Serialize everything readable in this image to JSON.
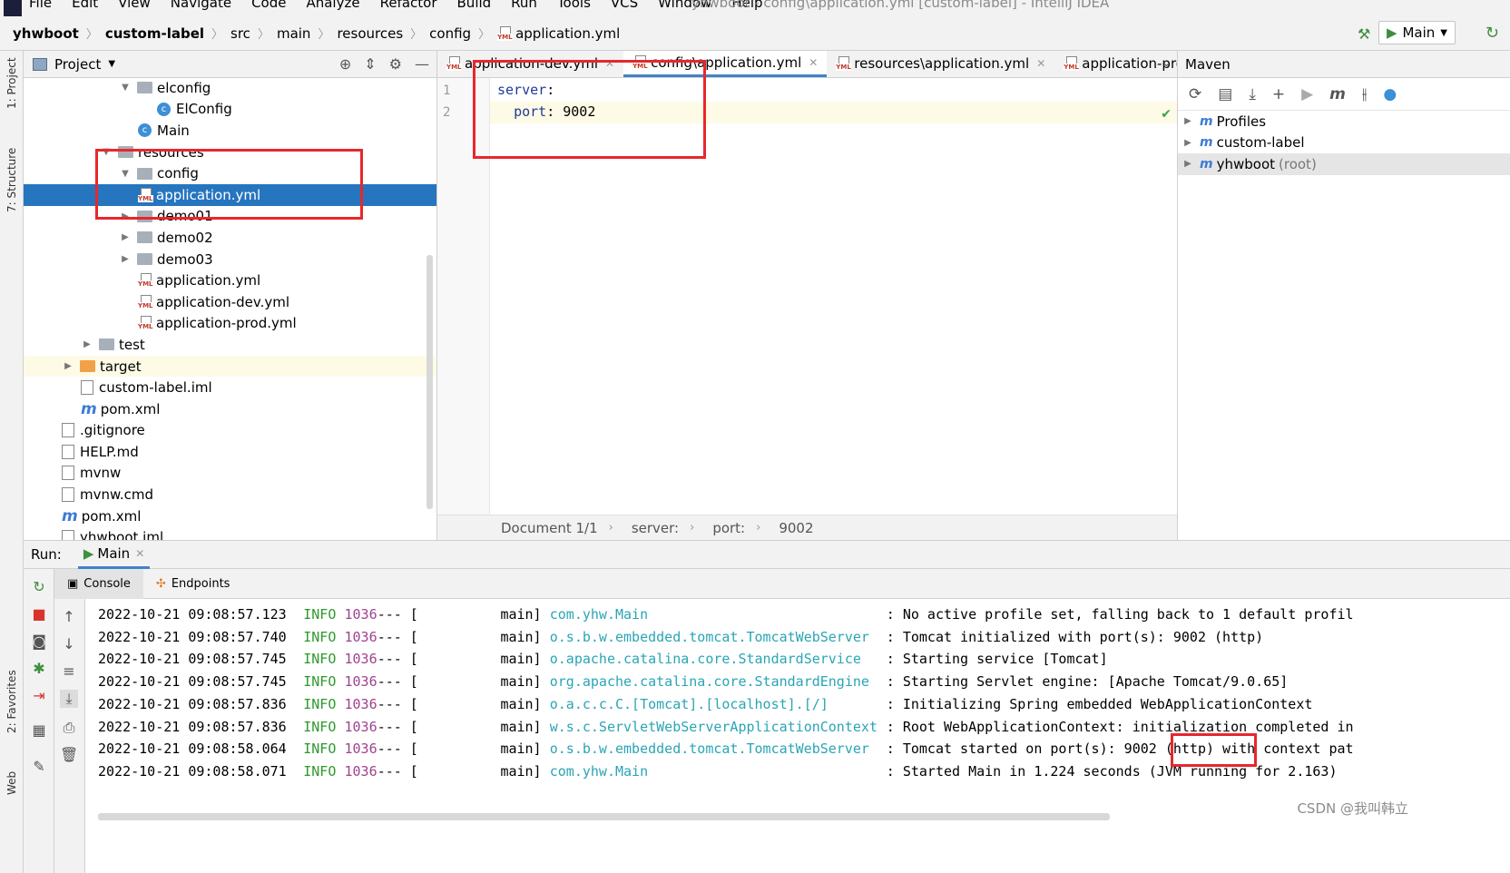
{
  "window_title": "yhwboot - config\\application.yml [custom-label] - IntelliJ IDEA",
  "menu": [
    "File",
    "Edit",
    "View",
    "Navigate",
    "Code",
    "Analyze",
    "Refactor",
    "Build",
    "Run",
    "Tools",
    "VCS",
    "Window",
    "Help"
  ],
  "breadcrumb": [
    "yhwboot",
    "custom-label",
    "src",
    "main",
    "resources",
    "config",
    "application.yml"
  ],
  "run_config": "Main",
  "side_labels": {
    "project": "1: Project",
    "structure": "7: Structure",
    "favorites": "2: Favorites",
    "web": "Web"
  },
  "project_panel": {
    "title": "Project",
    "tree": [
      {
        "label": "elconfig",
        "type": "package",
        "indent": 5,
        "arrow": "▼"
      },
      {
        "label": "ElConfig",
        "type": "class",
        "indent": 7,
        "arrow": ""
      },
      {
        "label": "Main",
        "type": "class-run",
        "indent": 6,
        "arrow": ""
      },
      {
        "label": "resources",
        "type": "folder-res",
        "indent": 4,
        "arrow": "▼"
      },
      {
        "label": "config",
        "type": "folder",
        "indent": 5,
        "arrow": "▼"
      },
      {
        "label": "application.yml",
        "type": "yml",
        "indent": 6,
        "arrow": "",
        "selected": true
      },
      {
        "label": "demo01",
        "type": "folder",
        "indent": 5,
        "arrow": "▶"
      },
      {
        "label": "demo02",
        "type": "folder",
        "indent": 5,
        "arrow": "▶"
      },
      {
        "label": "demo03",
        "type": "folder",
        "indent": 5,
        "arrow": "▶"
      },
      {
        "label": "application.yml",
        "type": "yml",
        "indent": 6,
        "arrow": ""
      },
      {
        "label": "application-dev.yml",
        "type": "yml",
        "indent": 6,
        "arrow": ""
      },
      {
        "label": "application-prod.yml",
        "type": "yml",
        "indent": 6,
        "arrow": ""
      },
      {
        "label": "test",
        "type": "folder",
        "indent": 3,
        "arrow": "▶"
      },
      {
        "label": "target",
        "type": "folder-orange",
        "indent": 2,
        "arrow": "▶",
        "highlight": true
      },
      {
        "label": "custom-label.iml",
        "type": "file",
        "indent": 3,
        "arrow": ""
      },
      {
        "label": "pom.xml",
        "type": "maven",
        "indent": 3,
        "arrow": ""
      },
      {
        "label": ".gitignore",
        "type": "file",
        "indent": 2,
        "arrow": ""
      },
      {
        "label": "HELP.md",
        "type": "md",
        "indent": 2,
        "arrow": ""
      },
      {
        "label": "mvnw",
        "type": "file",
        "indent": 2,
        "arrow": ""
      },
      {
        "label": "mvnw.cmd",
        "type": "file",
        "indent": 2,
        "arrow": ""
      },
      {
        "label": "pom.xml",
        "type": "maven",
        "indent": 2,
        "arrow": ""
      },
      {
        "label": "yhwboot.iml",
        "type": "file",
        "indent": 2,
        "arrow": ""
      }
    ]
  },
  "editor": {
    "tabs": [
      {
        "label": "application-dev.yml",
        "active": false
      },
      {
        "label": "config\\application.yml",
        "active": true
      },
      {
        "label": "resources\\application.yml",
        "active": false
      },
      {
        "label": "application-pro",
        "active": false
      }
    ],
    "lines": [
      {
        "n": "1",
        "key": "server",
        "sep": ":",
        "value": "",
        "indent": ""
      },
      {
        "n": "2",
        "key": "port",
        "sep": ": ",
        "value": "9002",
        "indent": "  "
      }
    ],
    "status": [
      "Document 1/1",
      "server:",
      "port:",
      "9002"
    ]
  },
  "maven": {
    "title": "Maven",
    "items": [
      {
        "label": "Profiles",
        "suffix": ""
      },
      {
        "label": "custom-label",
        "suffix": ""
      },
      {
        "label": "yhwboot",
        "suffix": "(root)"
      }
    ]
  },
  "run": {
    "label": "Run:",
    "tab": "Main",
    "subtabs": [
      "Console",
      "Endpoints"
    ],
    "log": [
      {
        "ts": "2022-10-21 09:08:57.123",
        "level": "INFO",
        "pid": "1036",
        "sep": "--- [",
        "thread": "main]",
        "logger": "com.yhw.Main",
        "msg": ": No active profile set, falling back to 1 default profil"
      },
      {
        "ts": "2022-10-21 09:08:57.740",
        "level": "INFO",
        "pid": "1036",
        "sep": "--- [",
        "thread": "main]",
        "logger": "o.s.b.w.embedded.tomcat.TomcatWebServer",
        "msg": ": Tomcat initialized with port(s): 9002 (http)"
      },
      {
        "ts": "2022-10-21 09:08:57.745",
        "level": "INFO",
        "pid": "1036",
        "sep": "--- [",
        "thread": "main]",
        "logger": "o.apache.catalina.core.StandardService",
        "msg": ": Starting service [Tomcat]"
      },
      {
        "ts": "2022-10-21 09:08:57.745",
        "level": "INFO",
        "pid": "1036",
        "sep": "--- [",
        "thread": "main]",
        "logger": "org.apache.catalina.core.StandardEngine",
        "msg": ": Starting Servlet engine: [Apache Tomcat/9.0.65]"
      },
      {
        "ts": "2022-10-21 09:08:57.836",
        "level": "INFO",
        "pid": "1036",
        "sep": "--- [",
        "thread": "main]",
        "logger": "o.a.c.c.C.[Tomcat].[localhost].[/]",
        "msg": ": Initializing Spring embedded WebApplicationContext"
      },
      {
        "ts": "2022-10-21 09:08:57.836",
        "level": "INFO",
        "pid": "1036",
        "sep": "--- [",
        "thread": "main]",
        "logger": "w.s.c.ServletWebServerApplicationContext",
        "msg": ": Root WebApplicationContext: initialization completed in"
      },
      {
        "ts": "2022-10-21 09:08:58.064",
        "level": "INFO",
        "pid": "1036",
        "sep": "--- [",
        "thread": "main]",
        "logger": "o.s.b.w.embedded.tomcat.TomcatWebServer",
        "msg": ": Tomcat started on port(s): 9002 (http) with context pat"
      },
      {
        "ts": "2022-10-21 09:08:58.071",
        "level": "INFO",
        "pid": "1036",
        "sep": "--- [",
        "thread": "main]",
        "logger": "com.yhw.Main",
        "msg": ": Started Main in 1.224 seconds (JVM running for 2.163)"
      }
    ]
  },
  "watermark": "CSDN @我叫韩立",
  "colors": {
    "selection": "#2675bf",
    "annotation_red": "#e8272b",
    "log_info": "#2c9a2c",
    "log_logger": "#2aa5b5"
  }
}
